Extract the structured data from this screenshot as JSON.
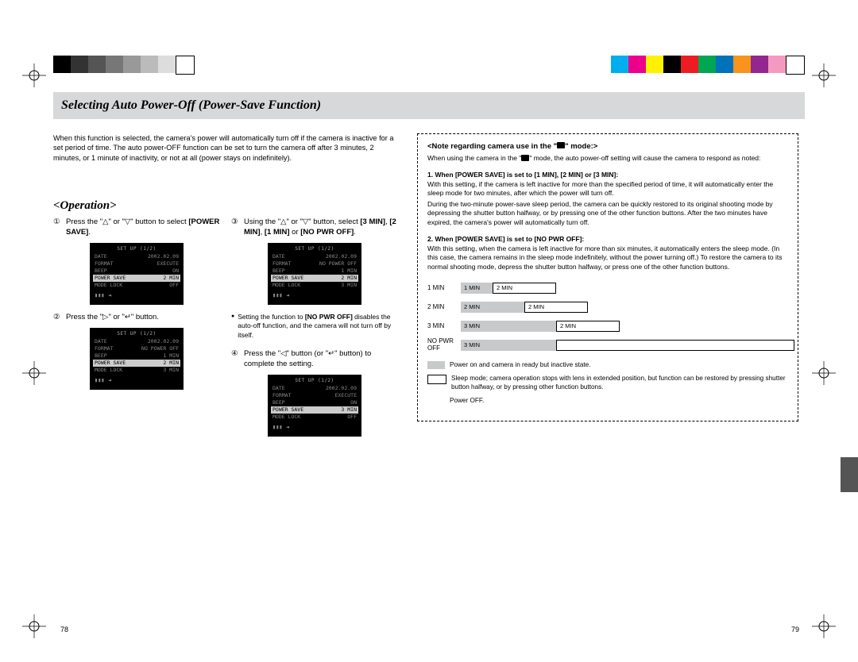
{
  "colorbar_left": [
    "#000000",
    "#333333",
    "#555555",
    "#777777",
    "#999999",
    "#bbbbbb",
    "#dddddd",
    "#ffffff"
  ],
  "colorbar_right": [
    "#00aeef",
    "#ec008c",
    "#fff200",
    "#000000",
    "#ed1c24",
    "#00a651",
    "#0072bc",
    "#f7941d",
    "#92278f",
    "#f49ac1",
    "#ffffff"
  ],
  "title": "Selecting Auto Power-Off (Power-Save Function)",
  "intro": "When this function is selected, the camera's power will automatically turn off if the camera is inactive for a set period of time. The auto power-OFF function can be set to turn the camera off after 3 minutes, 2 minutes, or 1 minute of inactivity, or not at all (power stays on indefinitely).",
  "operation_heading": "<Operation>",
  "steps": {
    "s1": {
      "num": "①",
      "pre": "Press the \"△\" or \"▽\" button to select ",
      "bold": "[POWER SAVE]",
      "post": "."
    },
    "s2": {
      "num": "②",
      "text": "Press the \"▷\" or \"↵\" button."
    },
    "s3": {
      "num": "③",
      "pre": "Using the \"△\" or \"▽\" button, select ",
      "b1": "[3 MIN]",
      "c1": ", ",
      "b2": "[2 MIN]",
      "c2": ", ",
      "b3": "[1 MIN]",
      "c3": " or ",
      "b4": "[NO PWR OFF]",
      "post": "."
    },
    "s4": {
      "num": "④",
      "text": "Press the \"◁\" button (or \"↵\" button) to complete the setting."
    }
  },
  "bullet_note": {
    "pre": "Setting the function to ",
    "b1": "[NO PWR OFF]",
    "post": " disables the auto-off function, and the camera will not turn off by itself."
  },
  "lcd1": {
    "title": "SET UP (1/2)",
    "rows": [
      [
        "DATE",
        "2002.02.09"
      ],
      [
        "FORMAT",
        "EXECUTE"
      ],
      [
        "BEEP",
        "ON"
      ]
    ],
    "hl": [
      "POWER SAVE",
      "2 MIN"
    ],
    "after": [
      [
        "MODE LOCK",
        "OFF"
      ]
    ]
  },
  "lcd2": {
    "title": "SET UP (1/2)",
    "rows": [
      [
        "DATE",
        "2002.02.09"
      ],
      [
        "FORMAT",
        "NO POWER OFF"
      ],
      [
        "BEEP",
        "1 MIN"
      ]
    ],
    "hl": [
      "POWER SAVE",
      "2 MIN"
    ],
    "after": [
      [
        "MODE LOCK",
        "3 MIN"
      ]
    ]
  },
  "lcd3": {
    "title": "SET UP (1/2)",
    "rows": [
      [
        "DATE",
        "2002.02.09"
      ],
      [
        "FORMAT",
        "NO POWER OFF"
      ],
      [
        "BEEP",
        "1 MIN"
      ]
    ],
    "hl": [
      "POWER SAVE",
      "2 MIN"
    ],
    "after": [
      [
        "MODE LOCK",
        "3 MIN"
      ]
    ]
  },
  "lcd4": {
    "title": "SET UP (1/2)",
    "rows": [
      [
        "DATE",
        "2002.02.09"
      ],
      [
        "FORMAT",
        "EXECUTE"
      ],
      [
        "BEEP",
        "ON"
      ]
    ],
    "hl": [
      "POWER SAVE",
      "3 MIN"
    ],
    "after": [
      [
        "MODE LOCK",
        "OFF"
      ]
    ]
  },
  "note": {
    "heading_pre": "<Note regarding camera use in the \"",
    "heading_post": "\" mode:>",
    "intro_pre": "When using the camera in the \"",
    "intro_post": "\" mode, the auto power-off setting will cause the camera to respond as noted:",
    "sub1": "1. When [POWER SAVE] is set to [1 MIN], [2 MIN] or [3 MIN]:",
    "p1": "With this setting, if the camera is left inactive for more than the specified period of time, it will automatically enter the sleep mode for two minutes, after which the power will turn off.",
    "p1b": "During the two-minute power-save sleep period, the camera can be quickly restored to its original shooting mode by depressing the shutter button halfway, or by pressing one of the other function buttons. After the two minutes have expired, the camera's power will automatically turn off.",
    "sub2": "2. When [POWER SAVE] is set to [NO PWR OFF]:",
    "p2": "With this setting, when the camera is left inactive for more than six minutes, it automatically enters the sleep mode. (In this case, the camera remains in the sleep mode indefinitely, without the power turning off.) To restore the camera to its normal shooting mode, depress the shutter button halfway, or press one of the other function buttons."
  },
  "chart_data": {
    "type": "bar",
    "rows": [
      {
        "label": "1 MIN",
        "a_label": "1 MIN",
        "a_width": 40,
        "b_label": "2 MIN",
        "b_width": 80
      },
      {
        "label": "2 MIN",
        "a_label": "2 MIN",
        "a_width": 80,
        "b_label": "2 MIN",
        "b_width": 80
      },
      {
        "label": "3 MIN",
        "a_label": "3 MIN",
        "a_width": 120,
        "b_label": "2 MIN",
        "b_width": 80
      },
      {
        "label": "NO PWR OFF",
        "a_label": "3 MIN",
        "a_width": 120,
        "b_label": "",
        "b_width": 300
      }
    ],
    "legend": [
      {
        "swatch": "grey",
        "text": "Power on and camera in ready but inactive state."
      },
      {
        "swatch": "white",
        "text": "Sleep mode; camera operation stops with lens in extended position, but function can be restored by pressing shutter button halfway, or by pressing other function buttons."
      },
      {
        "swatch": "none",
        "text": "Power OFF."
      }
    ]
  },
  "page_left": "78",
  "page_right": "79"
}
